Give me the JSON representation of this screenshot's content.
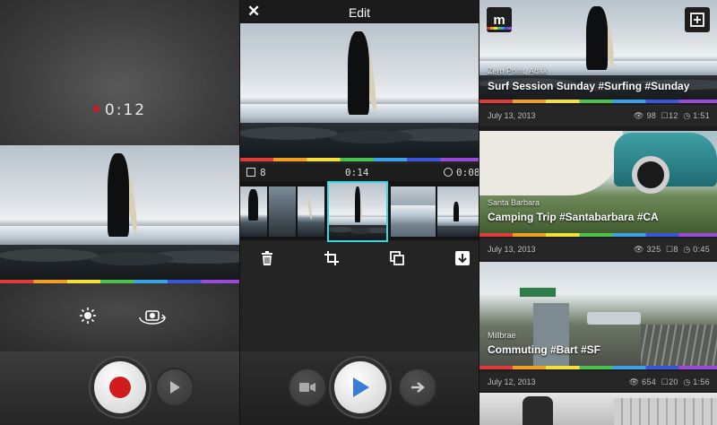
{
  "recorder": {
    "timer": "0:12",
    "icons": [
      "brightness-icon",
      "camera-flip-icon",
      "record-icon",
      "play-icon"
    ]
  },
  "editor": {
    "title": "Edit",
    "clip_count": "8",
    "timecode": "0:14",
    "duration": "0:08",
    "tools": [
      "trash-icon",
      "crop-icon",
      "duplicate-icon",
      "download-icon"
    ]
  },
  "feed": {
    "cards": [
      {
        "place": "Zero Point, Adak",
        "caption": "Surf Session Sunday #Surfing #Sunday",
        "date": "July 13, 2013",
        "views": "98",
        "clips": "12",
        "duration": "1:51"
      },
      {
        "place": "Santa Barbara",
        "caption": "Camping Trip #Santabarbara #CA",
        "date": "July 13, 2013",
        "views": "325",
        "clips": "8",
        "duration": "0:45"
      },
      {
        "place": "Millbrae",
        "caption": "Commuting #Bart #SF",
        "date": "July 12, 2013",
        "views": "654",
        "clips": "20",
        "duration": "1:56"
      }
    ]
  },
  "colors": {
    "accent": "#3ad7e2",
    "record": "#d01c1c",
    "play_blue": "#3a7bd5"
  }
}
